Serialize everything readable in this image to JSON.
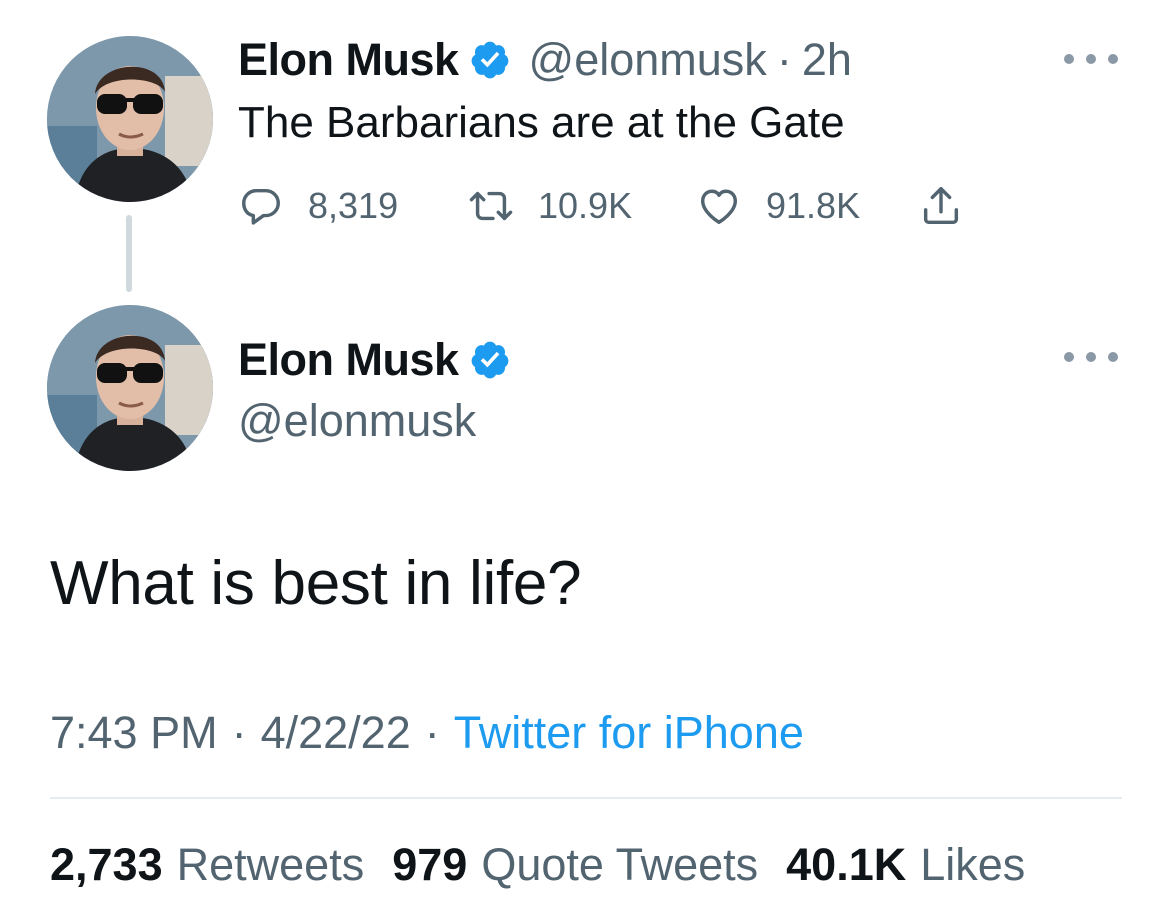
{
  "parent_tweet": {
    "author_name": "Elon Musk",
    "handle": "@elonmusk",
    "separator": "·",
    "time_ago": "2h",
    "text": "The Barbarians are at the Gate",
    "replies": "8,319",
    "retweets": "10.9K",
    "likes": "91.8K"
  },
  "main_tweet": {
    "author_name": "Elon Musk",
    "handle": "@elonmusk",
    "text": "What is best in life?",
    "time": "7:43 PM",
    "date": "4/22/22",
    "separator": "·",
    "source": "Twitter for iPhone"
  },
  "stats": {
    "retweets_count": "2,733",
    "retweets_label": "Retweets",
    "quote_tweets_count": "979",
    "quote_tweets_label": "Quote Tweets",
    "likes_count": "40.1K",
    "likes_label": "Likes"
  },
  "icons": {
    "verified": "verified-badge-icon",
    "reply": "reply-icon",
    "retweet": "retweet-icon",
    "like": "heart-icon",
    "share": "share-icon",
    "more": "more-options-icon"
  },
  "colors": {
    "accent": "#1d9bf0",
    "secondary_text": "#536471",
    "primary_text": "#0f1419"
  }
}
